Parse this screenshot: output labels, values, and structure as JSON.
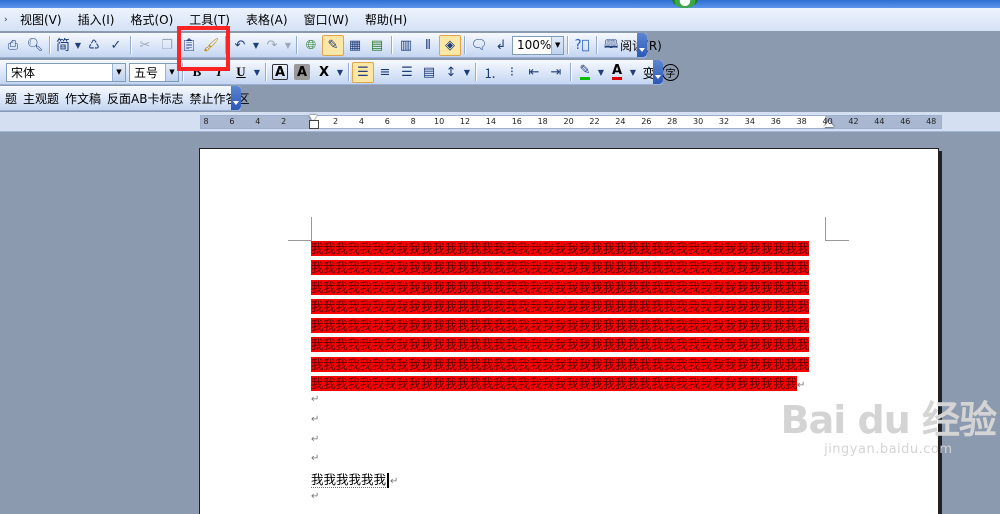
{
  "menubar": {
    "items": [
      "视图(V)",
      "插入(I)",
      "格式(O)",
      "工具(T)",
      "表格(A)",
      "窗口(W)",
      "帮助(H)"
    ]
  },
  "toolbar1": {
    "icons": [
      "print-icon",
      "print-preview-icon",
      "traditional-chinese-icon",
      "research-icon",
      "spelling-icon",
      "cut-icon",
      "copy-icon",
      "paste-icon",
      "format-painter-icon",
      "undo-icon",
      "redo-icon",
      "hyperlink-icon",
      "tables-borders-icon",
      "insert-table-icon",
      "insert-excel-icon",
      "columns-icon",
      "drawing-icon",
      "document-map-icon",
      "show-hide-icon",
      "ink-icon",
      "help-icon"
    ],
    "traditional_label": "简",
    "zoom_value": "100%",
    "read_label": "阅读(R)"
  },
  "toolbar2": {
    "font_name": "宋体",
    "font_size": "五号",
    "bold": "B",
    "italic": "I",
    "underline": "U",
    "char_border": "A",
    "char_shading": "A",
    "char_scale": "X",
    "highlight_color": "#00c000",
    "font_color": "#e00000",
    "phonetic_label": "变",
    "enclose_label": "字"
  },
  "toolbar3": {
    "items": [
      "题",
      "主观题",
      "作文稿",
      "反面AB卡标志",
      "禁止作答区"
    ]
  },
  "ruler": {
    "ticks": [
      "8",
      "6",
      "4",
      "2",
      "",
      "2",
      "4",
      "6",
      "8",
      "10",
      "12",
      "14",
      "16",
      "18",
      "20",
      "22",
      "24",
      "26",
      "28",
      "30",
      "32",
      "34",
      "36",
      "38",
      "40",
      "42",
      "44",
      "46",
      "48"
    ]
  },
  "document": {
    "selected_lines": [
      "我我我我我我我我我我我我我我我我我我我我我我我我我我我我我我我我我我我我我我我我我",
      "我我我我我我我我我我我我我我我我我我我我我我我我我我我我我我我我我我我我我我我我我",
      "我我我我我我我我我我我我我我我我我我我我我我我我我我我我我我我我我我我我我我我我我",
      "我我我我我我我我我我我我我我我我我我我我我我我我我我我我我我我我我我我我我我我我我",
      "我我我我我我我我我我我我我我我我我我我我我我我我我我我我我我我我我我我我我我我我我",
      "我我我我我我我我我我我我我我我我我我我我我我我我我我我我我我我我我我我我我我我我我",
      "我我我我我我我我我我我我我我我我我我我我我我我我我我我我我我我我我我我我我我我我我",
      "我我我我我我我我我我我我我我我我我我我我我我我我我我我我我我我我我我我我我我我我"
    ],
    "paragraph_mark": "↵",
    "last_line": "我我我我我我",
    "highlight_color": "#ff0000"
  },
  "watermark": {
    "brand": "Bai du 经验",
    "url": "jingyan.baidu.com"
  }
}
